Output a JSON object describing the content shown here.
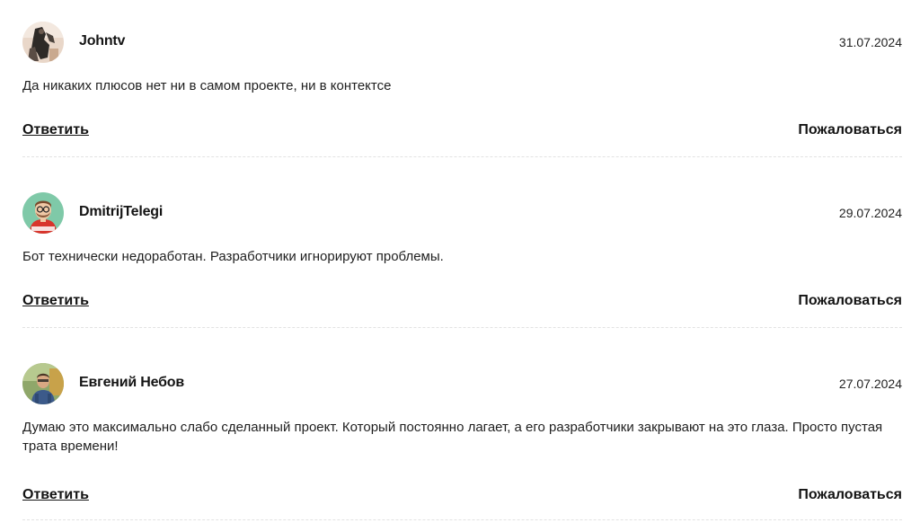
{
  "comments": [
    {
      "author": "Johntv",
      "date": "31.07.2024",
      "text": "Да никаких плюсов нет ни в самом проекте, ни в контектсе",
      "avatar_icon": "user-photo-avatar",
      "reply_label": "Ответить",
      "report_label": "Пожаловаться"
    },
    {
      "author": "DmitrijTelegi",
      "date": "29.07.2024",
      "text": "Бот технически недоработан. Разработчики игнорируют проблемы.",
      "avatar_icon": "cartoon-avatar",
      "reply_label": "Ответить",
      "report_label": "Пожаловаться"
    },
    {
      "author": "Евгений Небов",
      "date": "27.07.2024",
      "text": "Думаю это максимально слабо сделанный проект. Который постоянно лагает, а его разработчики закрывают на это глаза. Просто пустая трата времени!",
      "avatar_icon": "user-photo-avatar",
      "reply_label": "Ответить",
      "report_label": "Пожаловаться"
    }
  ],
  "colors": {
    "text": "#1f1f1f",
    "divider": "#e2e2e2",
    "background": "#ffffff"
  }
}
